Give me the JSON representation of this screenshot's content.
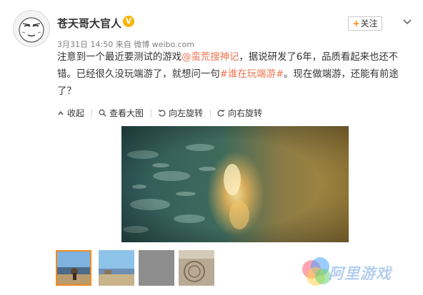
{
  "user": {
    "name": "苍天哥大官人",
    "verified_badge": "V",
    "avatar_icon": "doodle-face-avatar"
  },
  "post": {
    "date": "3月31日 14:50",
    "from_label": "来自",
    "source": "微博 weibo.com",
    "follow_plus": "+",
    "follow_label": "关注",
    "text_1": "注意到一个最近要测试的游戏",
    "mention": "@蛮荒搜神记",
    "text_2": "，据说研发了6年，品质看起来也还不错。已经很久没玩端游了，就想问一句",
    "hashtag": "#谁在玩端游#",
    "text_3": "。现在做端游，还能有前途了？"
  },
  "actions": {
    "collapse": "收起",
    "view_large": "查看大图",
    "rotate_left": "向左旋转",
    "rotate_right": "向右旋转"
  },
  "watermark": {
    "text": "阿里游戏",
    "logo_icon": "aligame-logo-icon"
  },
  "colors": {
    "link": "#eb7350",
    "meta": "#808080",
    "text": "#333333",
    "accent_orange": "#ff8200",
    "thumb_border": "#f28a1e",
    "badge": "#f7b500"
  }
}
